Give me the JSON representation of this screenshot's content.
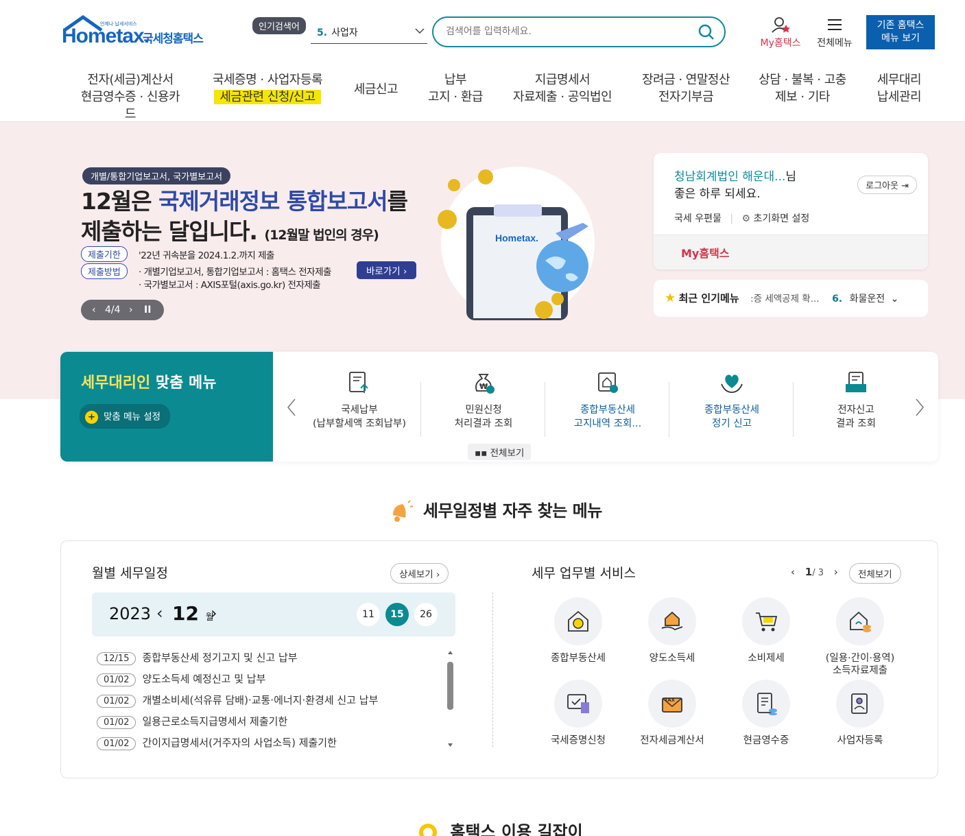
{
  "header": {
    "logo_hometax": "Hometax.",
    "logo_kr": "국세청홈택스",
    "logo_tiny": "언제나 납세서비스",
    "popular_badge": "인기검색어",
    "popular_num": "5.",
    "popular_term": "사업자",
    "search_placeholder": "검색어를 입력하세요.",
    "my_hometax": "My홈택스",
    "all_menu": "전체메뉴",
    "old_btn_1": "기존 홈택스",
    "old_btn_2": "메뉴 보기"
  },
  "gnb": [
    {
      "l1": "전자(세금)계산서",
      "l2": "현금영수증 · 신용카드"
    },
    {
      "l1": "국세증명 · 사업자등록",
      "l2": "세금관련 신청/신고"
    },
    {
      "l1": "세금신고",
      "l2": ""
    },
    {
      "l1": "납부",
      "l2": "고지 · 환급"
    },
    {
      "l1": "지급명세서",
      "l2": "자료제출 · 공익법인"
    },
    {
      "l1": "장려금 · 연말정산",
      "l2": "전자기부금"
    },
    {
      "l1": "상담 · 불복 · 고충",
      "l2": "제보 · 기타"
    },
    {
      "l1": "세무대리",
      "l2": "납세관리"
    }
  ],
  "hero": {
    "tag": "개별/통합기업보고서, 국가별보고서",
    "h1_a": "12월은 ",
    "h1_b": "국제거래정보 통합보고서",
    "h1_c": "를",
    "h1_d": "제출하는 달입니다.",
    "h1_e": "(12월말 법인의 경우)",
    "label_deadline": "제출기한",
    "deadline_text": "'22년 귀속분을 2024.1.2.까지 제출",
    "label_method": "제출방법",
    "method_1": "· 개별기업보고서, 통합기업보고서 : 홈택스 전자제출",
    "method_2": "· 국가별보고서 : AXIS포털(axis.go.kr) 전자제출",
    "go_btn": "바로가기",
    "pager": "4/4"
  },
  "user": {
    "name": "청남회계법인 해운대...",
    "name_suffix": "님",
    "greeting": "좋은 하루 되세요.",
    "logout": "로그아웃",
    "postbox": "국세 우편물",
    "init_setting": "초기화면 설정",
    "my_hometax": "My홈택스"
  },
  "recent": {
    "title": "최근 인기메뉴",
    "item1": ":증 세액공제 확...",
    "num": "6.",
    "item2": "화물운전"
  },
  "quick": {
    "title_a": "세무대리인",
    "title_b": " 맞춤 메뉴",
    "setting": "맞춤 메뉴 설정",
    "items": [
      {
        "l1": "국세납부",
        "l2": "(납부할세액 조회납부)"
      },
      {
        "l1": "민원신청",
        "l2": "처리결과 조회"
      },
      {
        "l1": "종합부동산세",
        "l2": "고지내역 조회..."
      },
      {
        "l1": "종합부동산세",
        "l2": "정기 신고"
      },
      {
        "l1": "전자신고",
        "l2": "결과 조회"
      }
    ],
    "all_view": "전체보기"
  },
  "section_title": "세무일정별 자주 찾는 메뉴",
  "calendar": {
    "title": "월별 세무일정",
    "detail": "상세보기",
    "year": "2023",
    "month": "12",
    "month_unit": "월",
    "days": [
      "11",
      "15",
      "26"
    ],
    "selected_day": "15",
    "schedule": [
      {
        "date": "12/15",
        "text": "종합부동산세 정기고지 및 신고 납부"
      },
      {
        "date": "01/02",
        "text": "양도소득세 예정신고 및 납부"
      },
      {
        "date": "01/02",
        "text": "개별소비세(석유류 담배)·교통·에너지·환경세 신고 납부"
      },
      {
        "date": "01/02",
        "text": "일용근로소득지급명세서 제출기한"
      },
      {
        "date": "01/02",
        "text": "간이지급명세서(거주자의 사업소득) 제출기한"
      }
    ]
  },
  "services": {
    "title": "세무 업무별 서비스",
    "page_current": "1",
    "page_total": "/ 3",
    "all": "전체보기",
    "items": [
      {
        "l1": "종합부동산세",
        "l2": ""
      },
      {
        "l1": "양도소득세",
        "l2": ""
      },
      {
        "l1": "소비제세",
        "l2": ""
      },
      {
        "l1": "(일용·간이·용역)",
        "l2": "소득자료제출"
      },
      {
        "l1": "국세증명신청",
        "l2": ""
      },
      {
        "l1": "전자세금계산서",
        "l2": ""
      },
      {
        "l1": "현금영수증",
        "l2": ""
      },
      {
        "l1": "사업자등록",
        "l2": ""
      }
    ]
  },
  "bottom_title": "홈택스 이용 길잡이"
}
